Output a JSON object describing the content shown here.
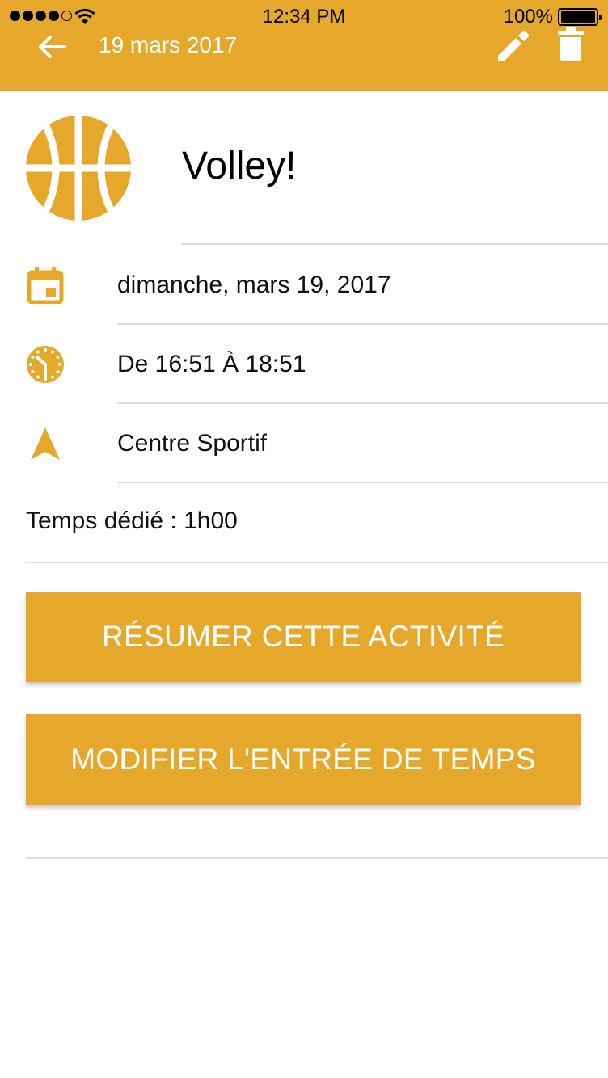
{
  "status_bar": {
    "time": "12:34 PM",
    "battery": "100%"
  },
  "appbar": {
    "title": "19 mars 2017",
    "icons": [
      "back-arrow-icon",
      "pencil-icon",
      "trash-icon"
    ]
  },
  "activity": {
    "icon": "basketball-icon",
    "title": "Volley!"
  },
  "details": {
    "date": "dimanche, mars 19, 2017",
    "time_range": "De 16:51 À 18:51",
    "location": "Centre Sportif",
    "time_spent": "Temps dédié : 1h00"
  },
  "actions": {
    "summarize": "RÉSUMER CETTE ACTIVITÉ",
    "edit_time": "MODIFIER L'ENTRÉE DE TEMPS"
  },
  "colors": {
    "accent": "#e6a82b",
    "divider": "#dedede"
  }
}
